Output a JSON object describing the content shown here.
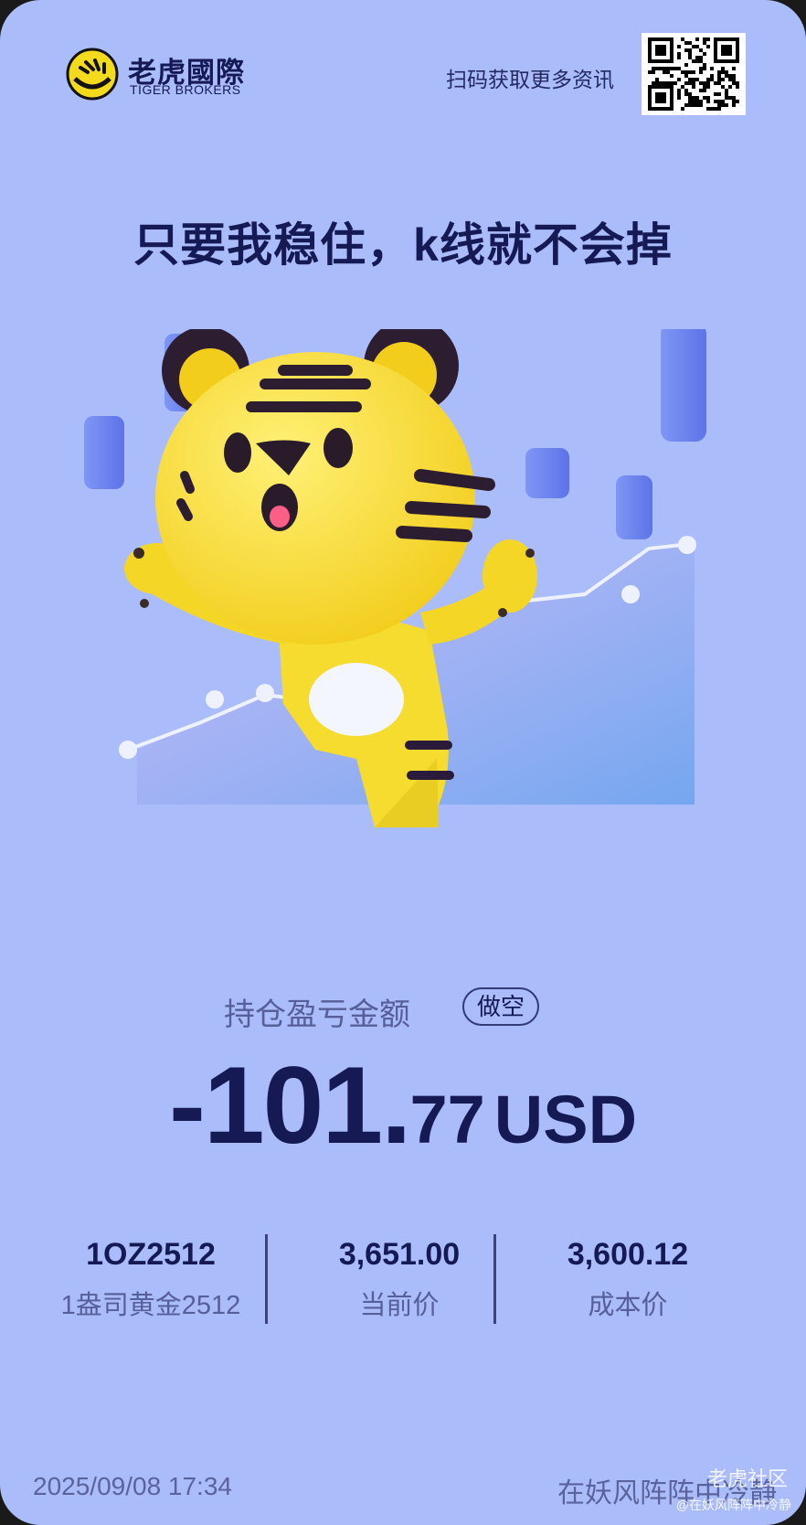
{
  "brand": {
    "name_cn": "老虎國際",
    "name_en": "TIGER BROKERS"
  },
  "header": {
    "scan_text": "扫码获取更多资讯"
  },
  "headline": "只要我稳住，k线就不会掉",
  "pnl": {
    "label": "持仓盈亏金额",
    "direction": "做空",
    "amount_int": "-101.",
    "amount_dec": "77",
    "currency": "USD"
  },
  "stats": [
    {
      "value": "1OZ2512",
      "label": "1盎司黄金2512"
    },
    {
      "value": "3,651.00",
      "label": "当前价"
    },
    {
      "value": "3,600.12",
      "label": "成本价"
    }
  ],
  "footer": {
    "datetime": "2025/09/08 17:34",
    "username": "在妖风阵阵中冷静"
  },
  "watermark": {
    "line1": "老虎社区",
    "line2": "@在妖风阵阵中冷静"
  },
  "colors": {
    "background": "#abbcfb",
    "text_dark": "#151a55",
    "text_muted": "#565f99",
    "tiger": "#f7e33a"
  },
  "icons": [
    "tiger-logo-icon",
    "qr-code",
    "tiger-mascot",
    "candlestick-icon"
  ]
}
